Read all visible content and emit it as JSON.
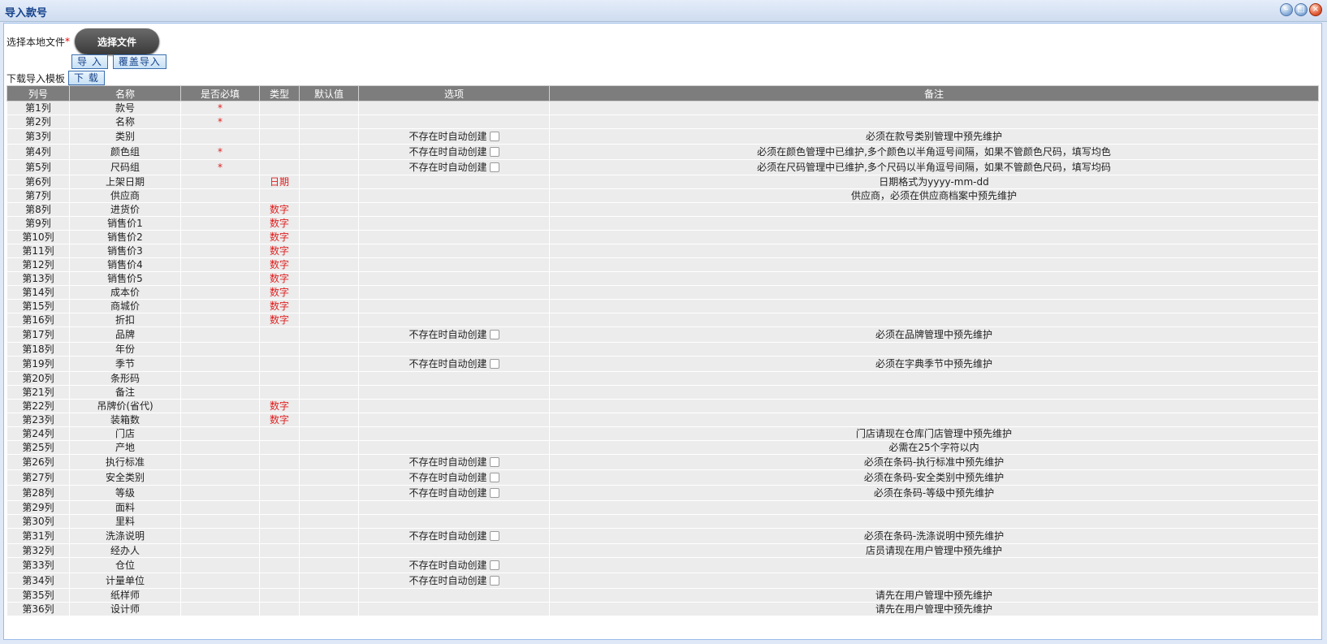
{
  "window": {
    "title": "导入款号"
  },
  "form": {
    "choose_label": "选择本地文件",
    "required_mark": "*",
    "choose_button": "选择文件",
    "import_button": "导 入",
    "overwrite_button": "覆盖导入",
    "template_label": "下载导入模板",
    "download_button": "下 载"
  },
  "table": {
    "headers": [
      "列号",
      "名称",
      "是否必填",
      "类型",
      "默认值",
      "选项",
      "备注"
    ],
    "option_text": "不存在时自动创建",
    "rows": [
      {
        "col": "第1列",
        "name": "款号",
        "req": "*",
        "type": "",
        "opt": false,
        "note": ""
      },
      {
        "col": "第2列",
        "name": "名称",
        "req": "*",
        "type": "",
        "opt": false,
        "note": ""
      },
      {
        "col": "第3列",
        "name": "类别",
        "req": "",
        "type": "",
        "opt": true,
        "note": "必须在款号类别管理中预先维护"
      },
      {
        "col": "第4列",
        "name": "颜色组",
        "req": "*",
        "type": "",
        "opt": true,
        "note": "必须在颜色管理中已维护,多个颜色以半角逗号间隔，如果不管颜色尺码，填写均色"
      },
      {
        "col": "第5列",
        "name": "尺码组",
        "req": "*",
        "type": "",
        "opt": true,
        "note": "必须在尺码管理中已维护,多个尺码以半角逗号间隔，如果不管颜色尺码，填写均码"
      },
      {
        "col": "第6列",
        "name": "上架日期",
        "req": "",
        "type": "日期",
        "opt": false,
        "note": "日期格式为yyyy-mm-dd"
      },
      {
        "col": "第7列",
        "name": "供应商",
        "req": "",
        "type": "",
        "opt": false,
        "note": "供应商，必须在供应商档案中预先维护"
      },
      {
        "col": "第8列",
        "name": "进货价",
        "req": "",
        "type": "数字",
        "opt": false,
        "note": ""
      },
      {
        "col": "第9列",
        "name": "销售价1",
        "req": "",
        "type": "数字",
        "opt": false,
        "note": ""
      },
      {
        "col": "第10列",
        "name": "销售价2",
        "req": "",
        "type": "数字",
        "opt": false,
        "note": ""
      },
      {
        "col": "第11列",
        "name": "销售价3",
        "req": "",
        "type": "数字",
        "opt": false,
        "note": ""
      },
      {
        "col": "第12列",
        "name": "销售价4",
        "req": "",
        "type": "数字",
        "opt": false,
        "note": ""
      },
      {
        "col": "第13列",
        "name": "销售价5",
        "req": "",
        "type": "数字",
        "opt": false,
        "note": ""
      },
      {
        "col": "第14列",
        "name": "成本价",
        "req": "",
        "type": "数字",
        "opt": false,
        "note": ""
      },
      {
        "col": "第15列",
        "name": "商城价",
        "req": "",
        "type": "数字",
        "opt": false,
        "note": ""
      },
      {
        "col": "第16列",
        "name": "折扣",
        "req": "",
        "type": "数字",
        "opt": false,
        "note": ""
      },
      {
        "col": "第17列",
        "name": "品牌",
        "req": "",
        "type": "",
        "opt": true,
        "note": "必须在品牌管理中预先维护"
      },
      {
        "col": "第18列",
        "name": "年份",
        "req": "",
        "type": "",
        "opt": false,
        "note": ""
      },
      {
        "col": "第19列",
        "name": "季节",
        "req": "",
        "type": "",
        "opt": true,
        "note": "必须在字典季节中预先维护"
      },
      {
        "col": "第20列",
        "name": "条形码",
        "req": "",
        "type": "",
        "opt": false,
        "note": ""
      },
      {
        "col": "第21列",
        "name": "备注",
        "req": "",
        "type": "",
        "opt": false,
        "note": ""
      },
      {
        "col": "第22列",
        "name": "吊牌价(省代)",
        "req": "",
        "type": "数字",
        "opt": false,
        "note": ""
      },
      {
        "col": "第23列",
        "name": "装箱数",
        "req": "",
        "type": "数字",
        "opt": false,
        "note": ""
      },
      {
        "col": "第24列",
        "name": "门店",
        "req": "",
        "type": "",
        "opt": false,
        "note": "门店请现在仓库门店管理中预先维护"
      },
      {
        "col": "第25列",
        "name": "产地",
        "req": "",
        "type": "",
        "opt": false,
        "note": "必需在25个字符以内"
      },
      {
        "col": "第26列",
        "name": "执行标准",
        "req": "",
        "type": "",
        "opt": true,
        "note": "必须在条码-执行标准中预先维护"
      },
      {
        "col": "第27列",
        "name": "安全类别",
        "req": "",
        "type": "",
        "opt": true,
        "note": "必须在条码-安全类别中预先维护"
      },
      {
        "col": "第28列",
        "name": "等级",
        "req": "",
        "type": "",
        "opt": true,
        "note": "必须在条码-等级中预先维护"
      },
      {
        "col": "第29列",
        "name": "面料",
        "req": "",
        "type": "",
        "opt": false,
        "note": ""
      },
      {
        "col": "第30列",
        "name": "里料",
        "req": "",
        "type": "",
        "opt": false,
        "note": ""
      },
      {
        "col": "第31列",
        "name": "洗涤说明",
        "req": "",
        "type": "",
        "opt": true,
        "note": "必须在条码-洗涤说明中预先维护"
      },
      {
        "col": "第32列",
        "name": "经办人",
        "req": "",
        "type": "",
        "opt": false,
        "note": "店员请现在用户管理中预先维护"
      },
      {
        "col": "第33列",
        "name": "仓位",
        "req": "",
        "type": "",
        "opt": true,
        "note": ""
      },
      {
        "col": "第34列",
        "name": "计量单位",
        "req": "",
        "type": "",
        "opt": true,
        "note": ""
      },
      {
        "col": "第35列",
        "name": "纸样师",
        "req": "",
        "type": "",
        "opt": false,
        "note": "请先在用户管理中预先维护"
      },
      {
        "col": "第36列",
        "name": "设计师",
        "req": "",
        "type": "",
        "opt": false,
        "note": "请先在用户管理中预先维护"
      }
    ]
  }
}
